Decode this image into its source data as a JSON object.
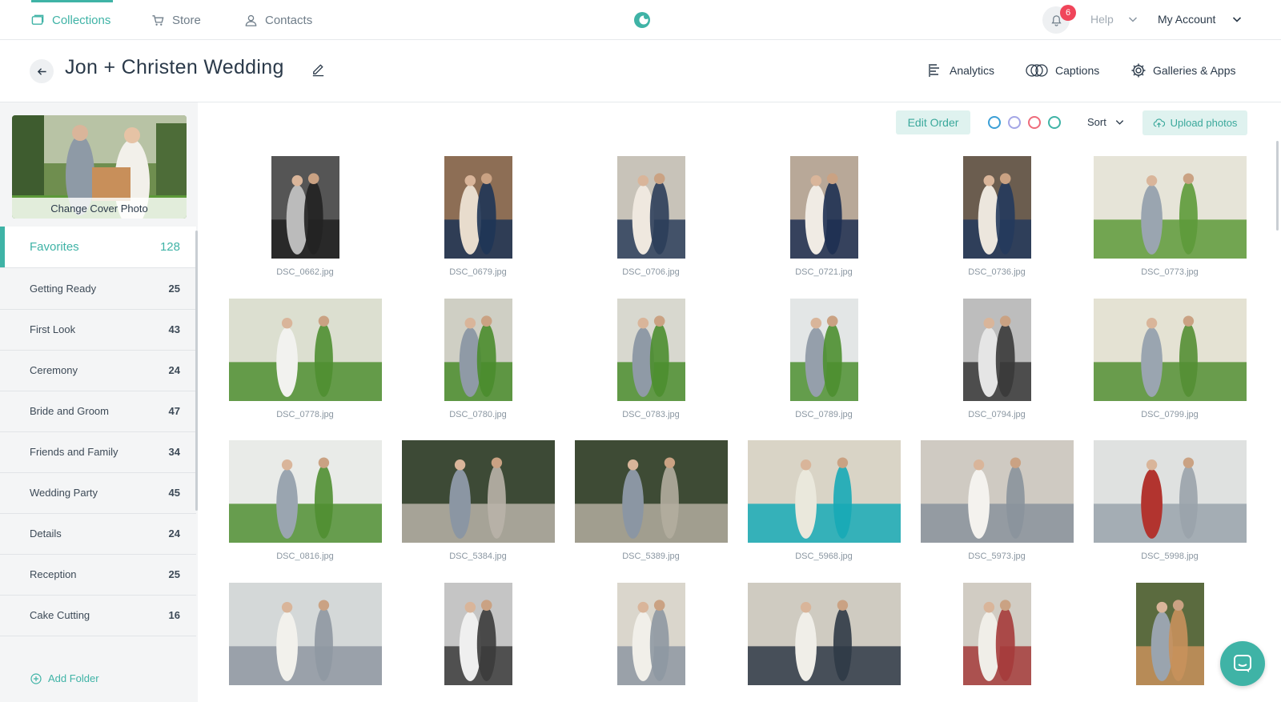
{
  "nav": {
    "collections": "Collections",
    "store": "Store",
    "contacts": "Contacts",
    "notifications_count": "6",
    "help": "Help",
    "account": "My Account"
  },
  "header": {
    "title": "Jon + Christen Wedding",
    "analytics": "Analytics",
    "captions": "Captions",
    "galleries": "Galleries & Apps"
  },
  "sidebar": {
    "cover_caption": "Change Cover Photo",
    "folders": [
      {
        "label": "Favorites",
        "count": "128"
      },
      {
        "label": "Getting Ready",
        "count": "25"
      },
      {
        "label": "First Look",
        "count": "43"
      },
      {
        "label": "Ceremony",
        "count": "24"
      },
      {
        "label": "Bride and Groom",
        "count": "47"
      },
      {
        "label": "Friends and Family",
        "count": "34"
      },
      {
        "label": "Wedding Party",
        "count": "45"
      },
      {
        "label": "Details",
        "count": "24"
      },
      {
        "label": "Reception",
        "count": "25"
      },
      {
        "label": "Cake Cutting",
        "count": "16"
      }
    ],
    "add_folder": "Add Folder"
  },
  "toolbar": {
    "edit_order": "Edit Order",
    "color_labels": [
      "#3b9fd6",
      "#a4a6e6",
      "#ee6b7a",
      "#3fb3a6"
    ],
    "sort": "Sort",
    "upload": "Upload photos"
  },
  "photos": [
    {
      "name": "DSC_0662.jpg",
      "orientation": "portrait",
      "palette": [
        "#555",
        "#222",
        "#bbb"
      ]
    },
    {
      "name": "DSC_0679.jpg",
      "orientation": "portrait",
      "palette": [
        "#8d6e55",
        "#1f3556",
        "#e8dccd"
      ]
    },
    {
      "name": "DSC_0706.jpg",
      "orientation": "portrait",
      "palette": [
        "#c8c3b9",
        "#2c3e5a",
        "#efe8df"
      ]
    },
    {
      "name": "DSC_0721.jpg",
      "orientation": "portrait",
      "palette": [
        "#b8a898",
        "#1e3052",
        "#f0ebe4"
      ]
    },
    {
      "name": "DSC_0736.jpg",
      "orientation": "portrait",
      "palette": [
        "#6b5d4f",
        "#253a5c",
        "#ece6dd"
      ]
    },
    {
      "name": "DSC_0773.jpg",
      "orientation": "landscape",
      "palette": [
        "#e6e4d8",
        "#5d9a3a",
        "#9aa5b0"
      ]
    },
    {
      "name": "DSC_0778.jpg",
      "orientation": "landscape",
      "palette": [
        "#dcdfd0",
        "#4f8f31",
        "#f2f2ef"
      ]
    },
    {
      "name": "DSC_0780.jpg",
      "orientation": "portrait",
      "palette": [
        "#cfcfc4",
        "#4a8c2d",
        "#8f9aa6"
      ]
    },
    {
      "name": "DSC_0783.jpg",
      "orientation": "portrait",
      "palette": [
        "#d8d8cf",
        "#4c8e2f",
        "#8f9aa6"
      ]
    },
    {
      "name": "DSC_0789.jpg",
      "orientation": "portrait",
      "palette": [
        "#e3e6e6",
        "#4d8f30",
        "#959fab"
      ]
    },
    {
      "name": "DSC_0794.jpg",
      "orientation": "portrait",
      "palette": [
        "#bdbdbd",
        "#3a3a3a",
        "#e5e5e5"
      ]
    },
    {
      "name": "DSC_0799.jpg",
      "orientation": "landscape",
      "palette": [
        "#e4e2d3",
        "#548f34",
        "#9aa5b0"
      ]
    },
    {
      "name": "DSC_0816.jpg",
      "orientation": "landscape",
      "palette": [
        "#e9ebe8",
        "#508f32",
        "#9aa5b0"
      ]
    },
    {
      "name": "DSC_5384.jpg",
      "orientation": "landscape",
      "palette": [
        "#3d4a36",
        "#b9b3a8",
        "#8b96a3"
      ]
    },
    {
      "name": "DSC_5389.jpg",
      "orientation": "landscape",
      "palette": [
        "#3e4b35",
        "#b3ad9f",
        "#8b96a3"
      ]
    },
    {
      "name": "DSC_5968.jpg",
      "orientation": "landscape",
      "palette": [
        "#d9d4c6",
        "#17aab6",
        "#eae8dc"
      ]
    },
    {
      "name": "DSC_5973.jpg",
      "orientation": "landscape",
      "palette": [
        "#cfcac2",
        "#8a939c",
        "#f4f2ee"
      ]
    },
    {
      "name": "DSC_5998.jpg",
      "orientation": "landscape",
      "palette": [
        "#dfe1e0",
        "#9aa3ab",
        "#b2342f"
      ]
    },
    {
      "name": "",
      "orientation": "landscape",
      "palette": [
        "#d4d8d8",
        "#8f98a2",
        "#f2f1ec"
      ]
    },
    {
      "name": "",
      "orientation": "portrait",
      "palette": [
        "#c5c5c5",
        "#3b3b3b",
        "#efefef"
      ]
    },
    {
      "name": "",
      "orientation": "portrait",
      "palette": [
        "#dad6cc",
        "#8e98a2",
        "#f1efe9"
      ]
    },
    {
      "name": "",
      "orientation": "landscape",
      "palette": [
        "#cfcbc1",
        "#2f3a46",
        "#f0eee8"
      ]
    },
    {
      "name": "",
      "orientation": "portrait",
      "palette": [
        "#d1ccc3",
        "#a53b3b",
        "#f0eee8"
      ]
    },
    {
      "name": "",
      "orientation": "portrait",
      "palette": [
        "#5b6b3f",
        "#c8915c",
        "#9aa4ae"
      ]
    }
  ]
}
